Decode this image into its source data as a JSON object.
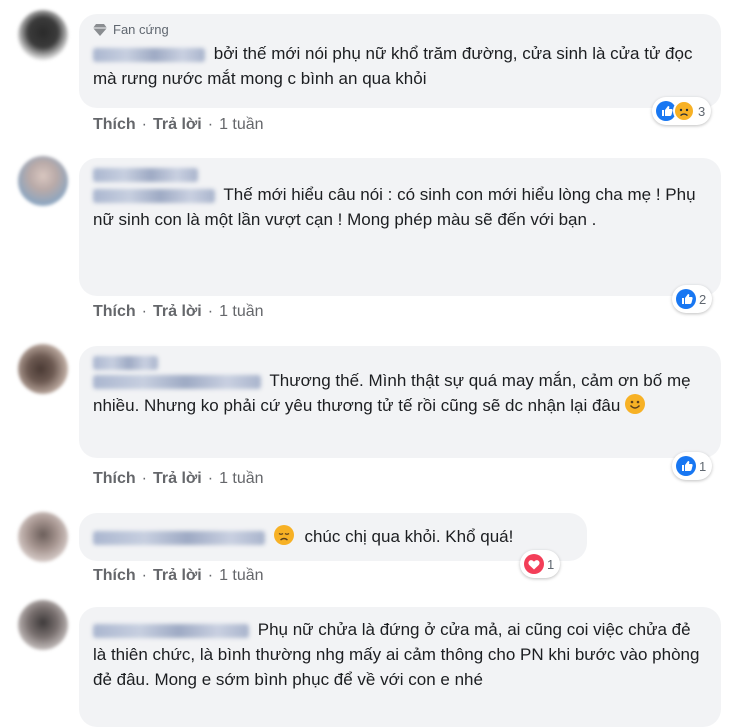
{
  "comments": [
    {
      "badge": "Fan cứng",
      "text": "bởi thế mới nói phụ nữ khổ trăm đường, cửa sinh là cửa tử đọc mà rưng nước mắt mong c bình an qua khỏi",
      "reaction_count": "3",
      "reactions": [
        "like-icon",
        "sad-icon"
      ]
    },
    {
      "text": "Thế mới hiểu câu nói : có sinh con mới hiểu lòng cha mẹ ! Phụ nữ sinh con là một lần vượt cạn ! Mong phép màu sẽ đến với bạn .",
      "reaction_count": "2",
      "reactions": [
        "like-icon"
      ]
    },
    {
      "text": "Thương thế. Mình thật sự quá may mắn, cảm ơn bố mẹ nhiều. Nhưng ko phải cứ yêu thương tử tế rồi cũng sẽ dc nhận lại đâu",
      "reaction_count": "1",
      "reactions": [
        "like-icon"
      ]
    },
    {
      "text": "chúc chị qua khỏi. Khổ quá!",
      "reaction_count": "1",
      "reactions": [
        "love-icon"
      ]
    },
    {
      "text": "Phụ nữ chửa là đứng ở cửa mả, ai cũng coi việc chửa đẻ là thiên chức, là bình thường nhg mấy ai cảm thông cho PN khi bước vào phòng đẻ đâu. Mong e sớm bình phục để về với con e nhé"
    }
  ],
  "actions": {
    "like": "Thích",
    "reply": "Trả lời",
    "separator": "·",
    "time": "1 tuần"
  },
  "colors": {
    "bubble": "#f2f3f5",
    "like": "#1877f2",
    "love": "#f33e58",
    "sad": "#f7b125"
  }
}
